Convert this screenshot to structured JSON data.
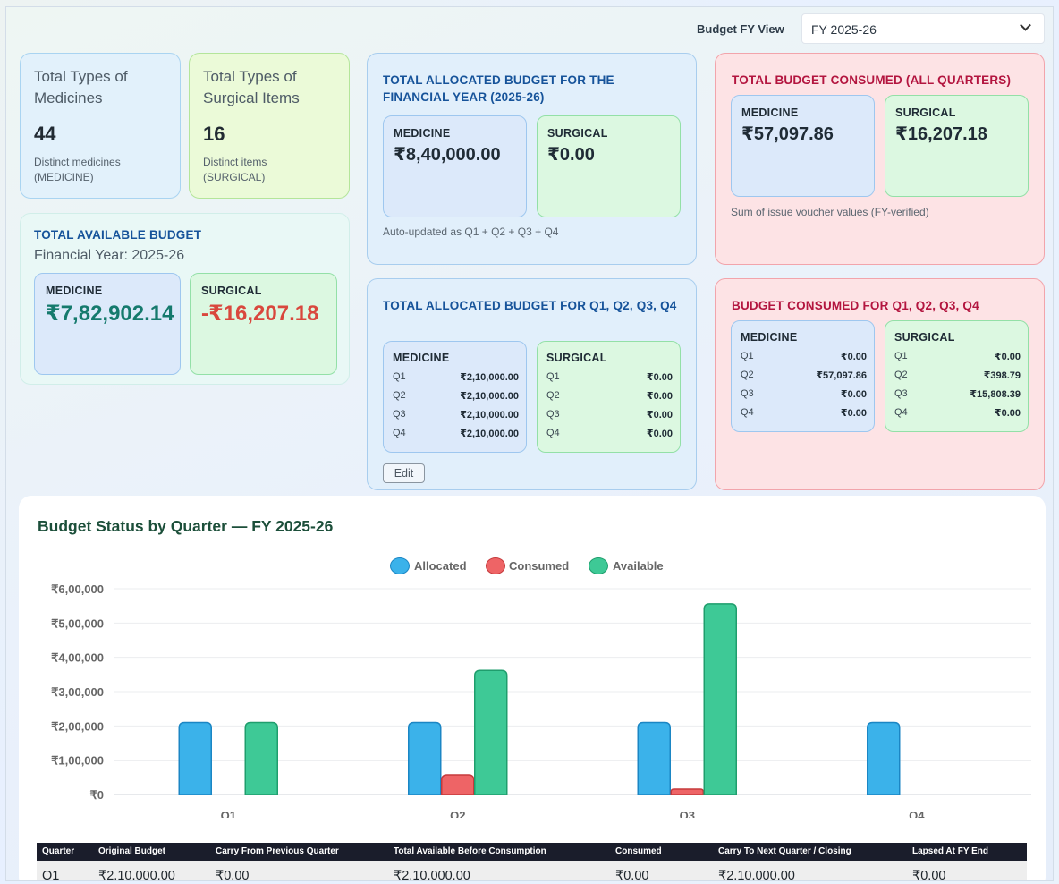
{
  "fy_view": {
    "label": "Budget FY View",
    "selected": "FY 2025-26"
  },
  "medicines_card": {
    "title": "Total Types of Medicines",
    "count": "44",
    "note": "Distinct medicines (MEDICINE)"
  },
  "surgical_card": {
    "title": "Total Types of Surgical Items",
    "count": "16",
    "note": "Distinct items (SURGICAL)"
  },
  "available_budget": {
    "title": "TOTAL AVAILABLE BUDGET",
    "subtitle": "Financial Year: 2025-26",
    "medicine_label": "MEDICINE",
    "medicine_value": "₹7,82,902.14",
    "surgical_label": "SURGICAL",
    "surgical_value": "-₹16,207.18"
  },
  "allocated_fy": {
    "title": "TOTAL ALLOCATED BUDGET FOR THE FINANCIAL YEAR (2025-26)",
    "medicine_label": "MEDICINE",
    "medicine_value": "₹8,40,000.00",
    "surgical_label": "SURGICAL",
    "surgical_value": "₹0.00",
    "note": "Auto-updated as Q1 + Q2 + Q3 + Q4"
  },
  "consumed_fy": {
    "title": "TOTAL BUDGET CONSUMED (ALL QUARTERS)",
    "medicine_label": "MEDICINE",
    "medicine_value": "₹57,097.86",
    "surgical_label": "SURGICAL",
    "surgical_value": "₹16,207.18",
    "note": "Sum of issue voucher values (FY-verified)"
  },
  "allocated_quarters": {
    "title": "TOTAL ALLOCATED BUDGET FOR Q1, Q2, Q3, Q4",
    "medicine_label": "MEDICINE",
    "surgical_label": "SURGICAL",
    "medicine_rows": [
      {
        "q": "Q1",
        "v": "₹2,10,000.00"
      },
      {
        "q": "Q2",
        "v": "₹2,10,000.00"
      },
      {
        "q": "Q3",
        "v": "₹2,10,000.00"
      },
      {
        "q": "Q4",
        "v": "₹2,10,000.00"
      }
    ],
    "surgical_rows": [
      {
        "q": "Q1",
        "v": "₹0.00"
      },
      {
        "q": "Q2",
        "v": "₹0.00"
      },
      {
        "q": "Q3",
        "v": "₹0.00"
      },
      {
        "q": "Q4",
        "v": "₹0.00"
      }
    ],
    "edit_label": "Edit"
  },
  "consumed_quarters": {
    "title": "BUDGET CONSUMED FOR Q1, Q2, Q3, Q4",
    "medicine_label": "MEDICINE",
    "surgical_label": "SURGICAL",
    "medicine_rows": [
      {
        "q": "Q1",
        "v": "₹0.00"
      },
      {
        "q": "Q2",
        "v": "₹57,097.86"
      },
      {
        "q": "Q3",
        "v": "₹0.00"
      },
      {
        "q": "Q4",
        "v": "₹0.00"
      }
    ],
    "surgical_rows": [
      {
        "q": "Q1",
        "v": "₹0.00"
      },
      {
        "q": "Q2",
        "v": "₹398.79"
      },
      {
        "q": "Q3",
        "v": "₹15,808.39"
      },
      {
        "q": "Q4",
        "v": "₹0.00"
      }
    ]
  },
  "chart_title": "Budget Status by Quarter — FY 2025-26",
  "chart_data": {
    "type": "bar",
    "categories": [
      "Q1",
      "Q2",
      "Q3",
      "Q4"
    ],
    "series": [
      {
        "name": "Allocated",
        "values": [
          210000,
          210000,
          210000,
          210000
        ],
        "color": "#3bb2ea"
      },
      {
        "name": "Consumed",
        "values": [
          0,
          57498,
          15808,
          0
        ],
        "color": "#ee6466"
      },
      {
        "name": "Available",
        "values": [
          210000,
          362000,
          556000,
          0
        ],
        "color": "#3ec996"
      }
    ],
    "y_ticks": [
      "₹0",
      "₹1,00,000",
      "₹2,00,000",
      "₹3,00,000",
      "₹4,00,000",
      "₹5,00,000",
      "₹6,00,000"
    ],
    "ylim": [
      0,
      600000
    ],
    "legend_position": "top-center",
    "grid": true
  },
  "table": {
    "headers": [
      "Quarter",
      "Original Budget",
      "Carry From Previous Quarter",
      "Total Available Before Consumption",
      "Consumed",
      "Carry To Next Quarter / Closing",
      "Lapsed At FY End"
    ],
    "rows": [
      [
        "Q1",
        "₹2,10,000.00",
        "₹0.00",
        "₹2,10,000.00",
        "₹0.00",
        "₹2,10,000.00",
        "₹0.00"
      ]
    ]
  }
}
